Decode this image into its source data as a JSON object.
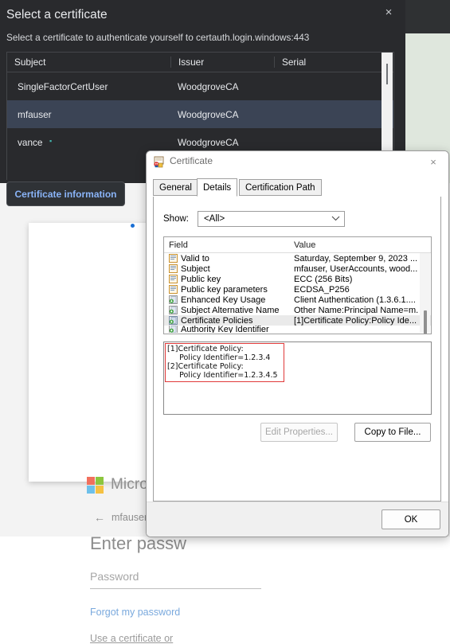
{
  "certificate_picker": {
    "title": "Select a certificate",
    "subtitle": "Select a certificate to authenticate yourself to certauth.login.windows:443",
    "close_label": "×",
    "columns": [
      "Subject",
      "Issuer",
      "Serial"
    ],
    "rows": [
      {
        "subject": "SingleFactorCertUser",
        "issuer": "WoodgroveCA",
        "serial": "",
        "selected": false
      },
      {
        "subject": "mfauser",
        "issuer": "WoodgroveCA",
        "serial": "",
        "selected": true
      },
      {
        "subject": "vance",
        "issuer": "WoodgroveCA",
        "serial": "",
        "selected": false
      }
    ],
    "info_button": "Certificate information",
    "selected_row_color": "#3b4455",
    "accent_color": "#8ab4f8"
  },
  "login_page": {
    "brand": "Microsoft",
    "account": "mfauser@wo",
    "back_arrow": "←",
    "heading": "Enter passw",
    "password_placeholder": "Password",
    "forgot_link": "Forgot my password",
    "certificate_link": "Use a certificate or",
    "logo_colors": {
      "red": "#f1705d",
      "green": "#8cc63e",
      "blue": "#6dc0ea",
      "yellow": "#f5c142"
    }
  },
  "certificate_dialog": {
    "title": "Certificate",
    "close_label": "×",
    "tabs": [
      {
        "label": "General",
        "active": false
      },
      {
        "label": "Details",
        "active": true
      },
      {
        "label": "Certification Path",
        "active": false
      }
    ],
    "show_label": "Show:",
    "show_value": "<All>",
    "chevron": "⌄",
    "field_columns": [
      "Field",
      "Value"
    ],
    "fields": [
      {
        "field": "Valid to",
        "value": "Saturday, September 9, 2023 ...",
        "icon": "certificate-field-icon",
        "icon_type": "orange",
        "selected": false
      },
      {
        "field": "Subject",
        "value": "mfauser, UserAccounts, wood...",
        "icon": "certificate-field-icon",
        "icon_type": "orange",
        "selected": false
      },
      {
        "field": "Public key",
        "value": "ECC (256 Bits)",
        "icon": "certificate-field-icon",
        "icon_type": "orange",
        "selected": false
      },
      {
        "field": "Public key parameters",
        "value": "ECDSA_P256",
        "icon": "certificate-field-icon",
        "icon_type": "orange",
        "selected": false
      },
      {
        "field": "Enhanced Key Usage",
        "value": "Client Authentication (1.3.6.1....",
        "icon": "certificate-extension-icon",
        "icon_type": "green",
        "selected": false
      },
      {
        "field": "Subject Alternative Name",
        "value": "Other Name:Principal Name=m...",
        "icon": "certificate-extension-icon",
        "icon_type": "green",
        "selected": false
      },
      {
        "field": "Certificate Policies",
        "value": "[1]Certificate Policy:Policy Ide...",
        "icon": "certificate-extension-icon",
        "icon_type": "green",
        "selected": true
      },
      {
        "field": "Authority Key Identifier",
        "value": "",
        "icon": "certificate-extension-icon",
        "icon_type": "green",
        "selected": false
      }
    ],
    "detail_lines": [
      "[1]Certificate Policy:",
      "     Policy Identifier=1.2.3.4",
      "[2]Certificate Policy:",
      "     Policy Identifier=1.2.3.4.5"
    ],
    "highlight_color": "#e03a3a",
    "edit_properties_button": "Edit Properties...",
    "copy_to_file_button": "Copy to File...",
    "ok_button": "OK"
  }
}
